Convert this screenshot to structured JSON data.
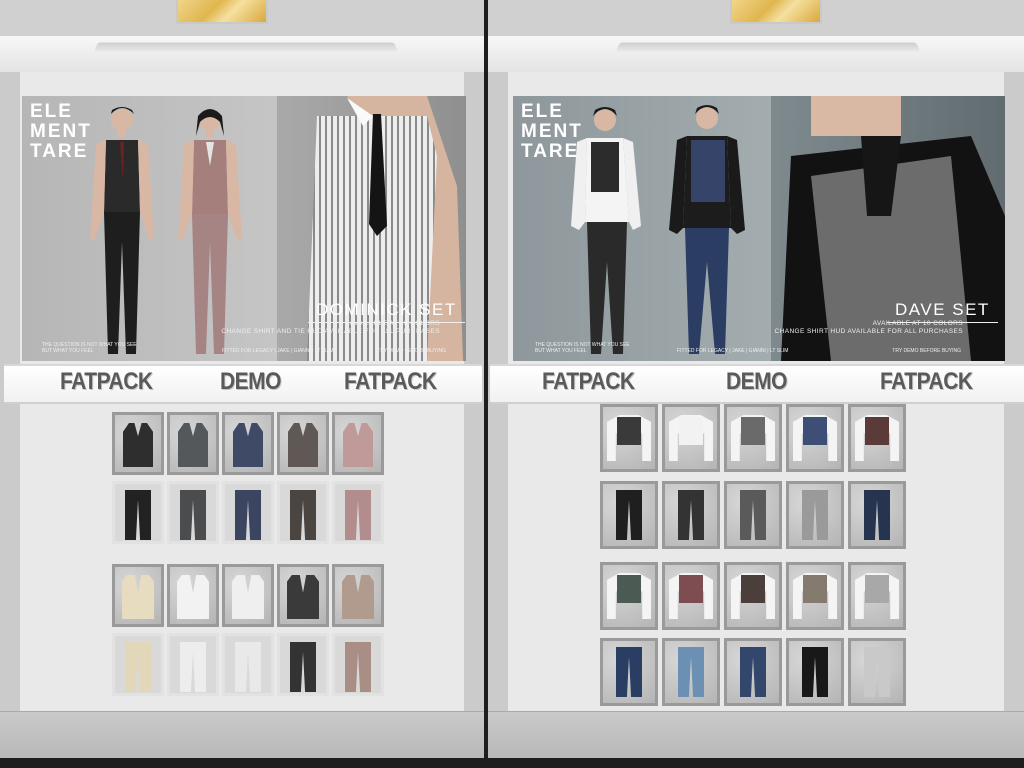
{
  "left_booth": {
    "poster": {
      "brand": [
        "ELE",
        "MENT",
        "TARE"
      ],
      "set_title": "DOMINICK SET",
      "sub_lines": [
        "AVAILABLE AT 10 COLORS",
        "CHANGE SHIRT AND TIE HUD AVAILABLE FOR ALL PURCHASES"
      ],
      "fine_left": "THE QUESTION IS NOT WHAT YOU SEE BUT WHAT YOU FEEL",
      "fine_mid": "FITTED FOR LEGACY | JAKE | GIANNI | LT SLIM",
      "fine_right": "TRY DEMO BEFORE BUYING"
    },
    "signs": [
      "FATPACK",
      "DEMO",
      "FATPACK"
    ],
    "vests": [
      "#2e2e2e",
      "#55585a",
      "#3f4a66",
      "#5f5854",
      "#c09a99"
    ],
    "pants1": [
      "#222222",
      "#4a4c4e",
      "#3b4560",
      "#4b4542",
      "#b38c8e"
    ],
    "jackets": [
      "#e7dcc0",
      "#f2f2f2",
      "#efefef",
      "#3a3a3a",
      "#b19b8f"
    ],
    "pants2": [
      "#e3d7ba",
      "#ededed",
      "#e9e9e9",
      "#333333",
      "#a98e85"
    ]
  },
  "right_booth": {
    "poster": {
      "brand": [
        "ELE",
        "MENT",
        "TARE"
      ],
      "set_title": "DAVE SET",
      "sub_lines": [
        "AVAILABLE AT 10 COLORS",
        "CHANGE SHIRT HUD AVAILABLE FOR ALL PURCHASES"
      ],
      "fine_left": "THE QUESTION IS NOT WHAT YOU SEE BUT WHAT YOU FEEL",
      "fine_mid": "FITTED FOR LEGACY | JAKE | GIANNI | LT SLIM",
      "fine_right": "TRY DEMO BEFORE BUYING"
    },
    "signs": [
      "FATPACK",
      "DEMO",
      "FATPACK"
    ],
    "tops1": [
      "#3a3a3a",
      "#f2f2f2",
      "#6a6a6a",
      "#3d4f74",
      "#5b3b3a"
    ],
    "pants1": [
      "#1f1f1f",
      "#333333",
      "#5a5a5a",
      "#9a9a9a",
      "#27344f"
    ],
    "tops2": [
      "#4b5a52",
      "#7e4d52",
      "#4a3f3b",
      "#857a70",
      "#a8a8a8"
    ],
    "pants2": [
      "#2a3d63",
      "#6c8fb4",
      "#32476b",
      "#181818",
      "#c9c9c9"
    ]
  }
}
